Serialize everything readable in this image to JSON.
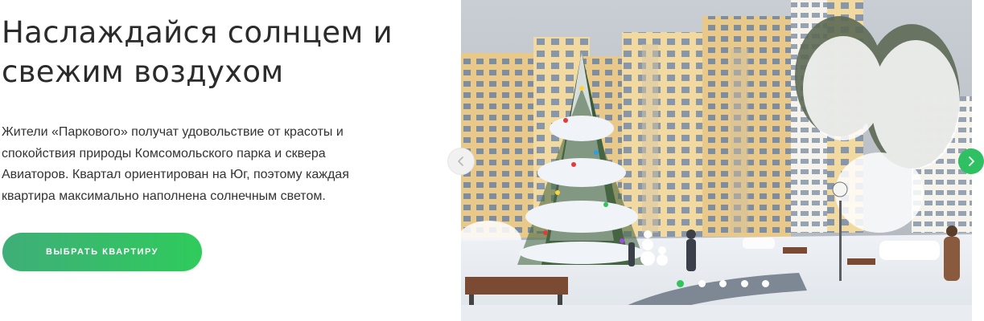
{
  "intro": {
    "title_lines": [
      "Наслаждайся солнцем и",
      "свежим воздухом"
    ],
    "description_lines": [
      "Жители «Паркового» получат удовольствие от красоты и",
      "спокойствия природы Комсомольского парка и сквера",
      "Авиаторов. Квартал ориентирован на Юг, поэтому каждая",
      "квартира максимально наполнена солнечным светом."
    ],
    "cta_label": "ВЫБРАТЬ КВАРТИРУ"
  },
  "slider": {
    "slide_count": 5,
    "active_slide": 1,
    "prev_icon": "chevron-left-icon",
    "next_icon": "chevron-right-icon"
  },
  "colors": {
    "accent_green": "#2ec062",
    "button_gradient_start": "#3fae78",
    "button_gradient_end": "#2fcb5c",
    "title_text": "#2b2b2b",
    "body_text": "#333333"
  }
}
